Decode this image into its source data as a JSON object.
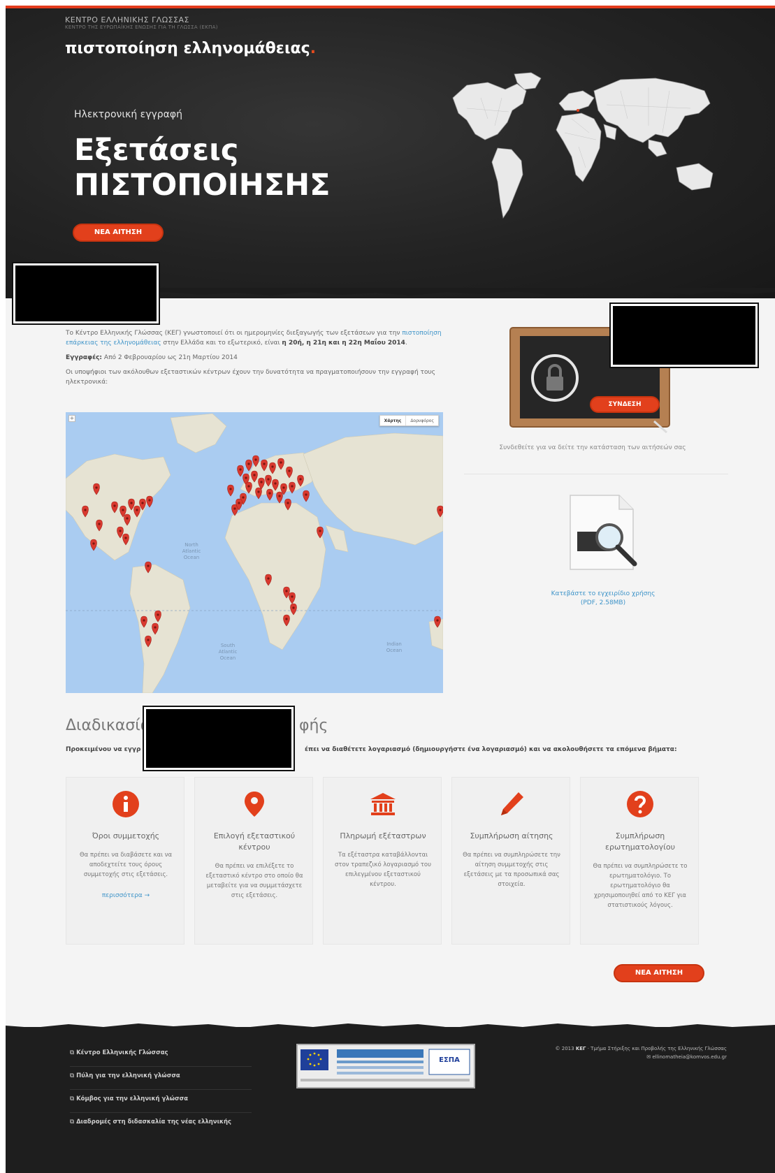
{
  "header": {
    "org_name": "ΚΕΝΤΡΟ ΕΛΛΗΝΙΚΗΣ ΓΛΩΣΣΑΣ",
    "org_subtitle": "ΚΕΝΤΡΟ ΤΗΣ ΕΥΡΩΠΑΪΚΗΣ ΕΝΩΣΗΣ ΓΙΑ ΤΗ ΓΛΩΣΣΑ (ΕΚΠΑ)",
    "brand": "πιστοποίηση ελληνομάθειας",
    "brand_dot": "."
  },
  "hero": {
    "kicker": "Ηλεκτρονική εγγραφή",
    "title_line1": "Εξετάσεις",
    "title_line2": "ΠΙΣΤΟΠΟΙΗΣΗΣ",
    "button_label": "ΝΕΑ ΑΙΤΗΣΗ"
  },
  "intro": {
    "p1_start": "Το Κέντρο Ελληνικής Γλώσσας (ΚΕΓ) γνωστοποιεί ότι οι ημερομηνίες διεξαγωγής των εξετάσεων για την",
    "p1_link": "πιστοποίηση επάρκειας της ελληνομάθειας",
    "p1_mid": "στην Ελλάδα και το εξωτερικό, είναι",
    "p1_bold": "η 20ή, η 21η και η 22η Μαΐου 2014",
    "p1_end": ".",
    "p2_label": "Εγγραφές:",
    "p2_text": "Από 2 Φεβρουαρίου ως 21η Μαρτίου 2014",
    "p3": "Οι υποψήφιοι των ακόλουθων εξεταστικών κέντρων έχουν την δυνατότητα να πραγματοποιήσουν την εγγραφή τους ηλεκτρονικά:"
  },
  "map": {
    "toggle_map": "Χάρτης",
    "toggle_satellite": "Δορυφόρος",
    "zoom": "+"
  },
  "login": {
    "button_label": "ΣΥΝΔΕΣΗ",
    "note": "Συνδεθείτε για να δείτε την κατάσταση των αιτήσεών σας"
  },
  "manual": {
    "link_line1": "Κατεβάστε το εγχειρίδιο χρήσης",
    "link_line2": "(PDF, 2.58MB)"
  },
  "process": {
    "title_start": "Διαδικασία",
    "title_end": "φής",
    "text_start": "Προκειμένου να εγγρ",
    "text_mid": "έπει να διαθέτετε λογαριασμό (",
    "text_link": "δημιουργήστε ένα λογαριασμό",
    "text_end": ") και να ακολουθήσετε τα επόμενα βήματα:",
    "steps": [
      {
        "title": "Όροι συμμετοχής",
        "desc": "Θα πρέπει να διαβάσετε και να αποδεχτείτε τους όρους συμμετοχής στις εξετάσεις.",
        "more": "περισσότερα →",
        "icon": "info-icon"
      },
      {
        "title": "Επιλογή εξεταστικού κέντρου",
        "desc": "Θα πρέπει να επιλέξετε το εξεταστικό κέντρο στο οποίο θα μεταβείτε για να συμμετάσχετε στις εξετάσεις.",
        "icon": "map-marker-icon"
      },
      {
        "title": "Πληρωμή εξέταστρων",
        "desc": "Τα εξέταστρα καταβάλλονται στον τραπεζικό λογαριασμό του επιλεγμένου εξεταστικού κέντρου.",
        "icon": "bank-icon"
      },
      {
        "title": "Συμπλήρωση αίτησης",
        "desc": "Θα πρέπει να συμπληρώσετε την αίτηση συμμετοχής στις εξετάσεις με τα προσωπικά σας στοιχεία.",
        "icon": "pencil-icon"
      },
      {
        "title": "Συμπλήρωση ερωτηματολογίου",
        "desc": "Θα πρέπει να συμπληρώσετε το ερωτηματολόγιο. Το ερωτηματολόγιο θα χρησιμοποιηθεί από το ΚΕΓ για στατιστικούς λόγους.",
        "icon": "question-icon"
      }
    ],
    "button_label": "ΝΕΑ ΑΙΤΗΣΗ"
  },
  "footer": {
    "links": [
      "Κέντρο Ελληνικής Γλώσσας",
      "Πύλη για την ελληνική γλώσσα",
      "Κόμβος για την ελληνική γλώσσα",
      "Διαδρομές στη διδασκαλία της νέας ελληνικής"
    ],
    "copyright_year": "© 2013",
    "copyright_org": "ΚΕΓ",
    "copyright_rest": "· Τμήμα Στήριξης και Προβολής της Ελληνικής Γλώσσας",
    "email": "ellinomatheia@komvos.edu.gr",
    "banner_label": "ΕΣΠΑ"
  },
  "colors": {
    "accent": "#e2401c",
    "link": "#3d93c8",
    "hero_bg": "#232323",
    "map_water": "#aaccf1",
    "map_land": "#e6e3d3",
    "pin": "#d9392f"
  }
}
